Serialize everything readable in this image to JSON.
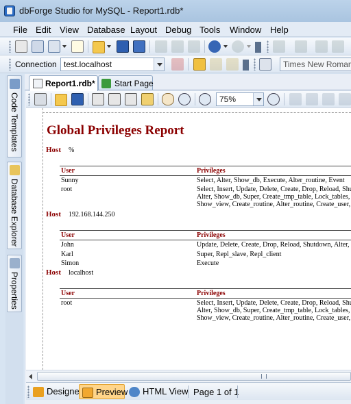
{
  "window": {
    "title": "dbForge Studio for MySQL - Report1.rdb*"
  },
  "menu": {
    "items": [
      "File",
      "Edit",
      "View",
      "Database",
      "Layout",
      "Debug",
      "Tools",
      "Window",
      "Help"
    ]
  },
  "connection": {
    "label": "Connection",
    "value": "test.localhost",
    "font_value": "Times New Roman"
  },
  "sidebar": {
    "tabs": [
      "Code Templates",
      "Database Explorer",
      "Properties"
    ]
  },
  "doc_tabs": [
    {
      "label": "Report1.rdb*",
      "active": true
    },
    {
      "label": "Start Page",
      "active": false
    }
  ],
  "preview_toolbar": {
    "zoom": "75%"
  },
  "report": {
    "title": "Global Privileges Report",
    "host_label": "Host",
    "col_user": "User",
    "col_privileges": "Privileges",
    "groups": [
      {
        "host": "%",
        "rows": [
          {
            "user": "Sunny",
            "privileges": [
              "Select, Alter, Show_db, Execute, Alter_routine, Event"
            ]
          },
          {
            "user": "root",
            "privileges": [
              "Select, Insert, Update, Delete, Create, Drop, Reload, Shu",
              "Alter, Show_db, Super, Create_tmp_table, Lock_tables,",
              "Show_view, Create_routine, Alter_routine, Create_user,"
            ]
          }
        ]
      },
      {
        "host": "192.168.144.250",
        "rows": [
          {
            "user": "John",
            "privileges": [
              "Update, Delete, Create, Drop, Reload, Shutdown, Alter,"
            ]
          },
          {
            "user": "Karl",
            "privileges": [
              "Super, Repl_slave, Repl_client"
            ]
          },
          {
            "user": "Simon",
            "privileges": [
              "Execute"
            ]
          }
        ]
      },
      {
        "host": "localhost",
        "rows": [
          {
            "user": "root",
            "privileges": [
              "Select, Insert, Update, Delete, Create, Drop, Reload, Shu",
              "Alter, Show_db, Super, Create_tmp_table, Lock_tables,",
              "Show_view, Create_routine, Alter_routine, Create_user,"
            ]
          }
        ]
      }
    ]
  },
  "bottom_tabs": [
    {
      "label": "Designer",
      "icon": "designer-icon",
      "selected": false
    },
    {
      "label": "Preview",
      "icon": "preview-icon",
      "selected": true
    },
    {
      "label": "HTML View",
      "icon": "html-view-icon",
      "selected": false
    }
  ],
  "page_indicator": "Page 1 of 1",
  "colors": {
    "report_accent": "#8b0000",
    "selected_tab": "#ffd58a",
    "chrome": "#d7e4f2"
  }
}
